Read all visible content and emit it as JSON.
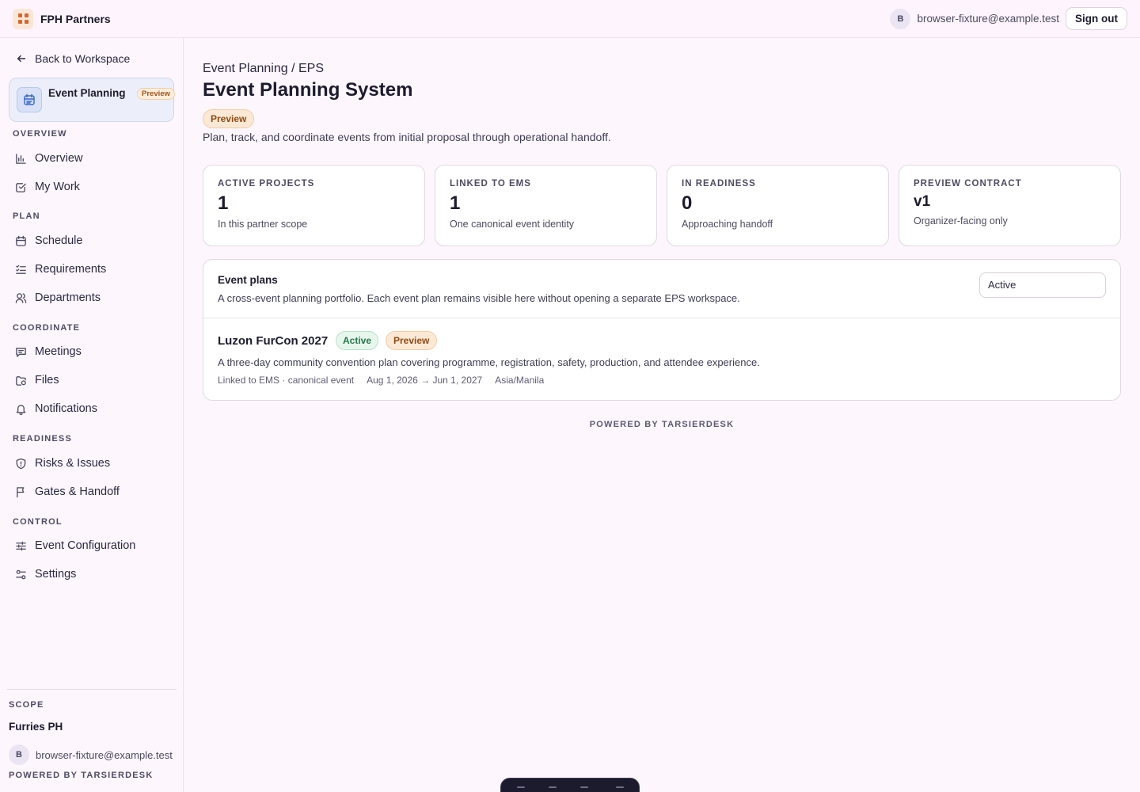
{
  "header": {
    "brand": "FPH Partners",
    "user_initial": "B",
    "user_email": "browser-fixture@example.test",
    "sign_out_label": "Sign out"
  },
  "sidebar": {
    "back_label": "Back to Workspace",
    "module": {
      "title": "Event Planning",
      "badge": "Preview"
    },
    "sections": [
      {
        "label": "OVERVIEW",
        "items": [
          {
            "label": "Overview",
            "icon": "bar-chart-icon"
          },
          {
            "label": "My Work",
            "icon": "checkbox-icon"
          }
        ]
      },
      {
        "label": "PLAN",
        "items": [
          {
            "label": "Schedule",
            "icon": "calendar-icon"
          },
          {
            "label": "Requirements",
            "icon": "list-check-icon"
          },
          {
            "label": "Departments",
            "icon": "users-icon"
          }
        ]
      },
      {
        "label": "COORDINATE",
        "items": [
          {
            "label": "Meetings",
            "icon": "message-icon"
          },
          {
            "label": "Files",
            "icon": "folder-icon"
          },
          {
            "label": "Notifications",
            "icon": "bell-icon"
          }
        ]
      },
      {
        "label": "READINESS",
        "items": [
          {
            "label": "Risks & Issues",
            "icon": "shield-icon"
          },
          {
            "label": "Gates & Handoff",
            "icon": "flag-icon"
          }
        ]
      },
      {
        "label": "CONTROL",
        "items": [
          {
            "label": "Event Configuration",
            "icon": "sliders-icon"
          },
          {
            "label": "Settings",
            "icon": "settings-icon"
          }
        ]
      }
    ],
    "scope_label": "SCOPE",
    "scope_name": "Furries PH",
    "user_initial": "B",
    "user_email": "browser-fixture@example.test",
    "powered_by": "POWERED BY TARSIERDESK"
  },
  "main": {
    "breadcrumb": "Event Planning / EPS",
    "title": "Event Planning System",
    "badge": "Preview",
    "description": "Plan, track, and coordinate events from initial proposal through operational handoff.",
    "stats": [
      {
        "label": "ACTIVE PROJECTS",
        "value": "1",
        "sub": "In this partner scope"
      },
      {
        "label": "LINKED TO EMS",
        "value": "1",
        "sub": "One canonical event identity"
      },
      {
        "label": "IN READINESS",
        "value": "0",
        "sub": "Approaching handoff"
      },
      {
        "label": "PREVIEW CONTRACT",
        "value": "v1",
        "sub": "Organizer-facing only"
      }
    ],
    "plans": {
      "title": "Event plans",
      "description": "A cross-event planning portfolio. Each event plan remains visible here without opening a separate EPS workspace.",
      "filter_value": "Active",
      "items": [
        {
          "name": "Luzon FurCon 2027",
          "status": "Active",
          "badge": "Preview",
          "description": "A three-day community convention plan covering programme, registration, safety, production, and attendee experience.",
          "link": "Linked to EMS · canonical event",
          "dates": "Aug 1, 2026 → Jun 1, 2027",
          "timezone": "Asia/Manila"
        }
      ]
    },
    "powered_by": "POWERED BY TARSIERDESK"
  },
  "colors": {
    "background": "#fdf6fd",
    "accent_orange": "#d9662f",
    "preview_badge": "#fbe9d6",
    "active_badge": "#e7f6ec",
    "module_highlight": "#eceff9"
  }
}
